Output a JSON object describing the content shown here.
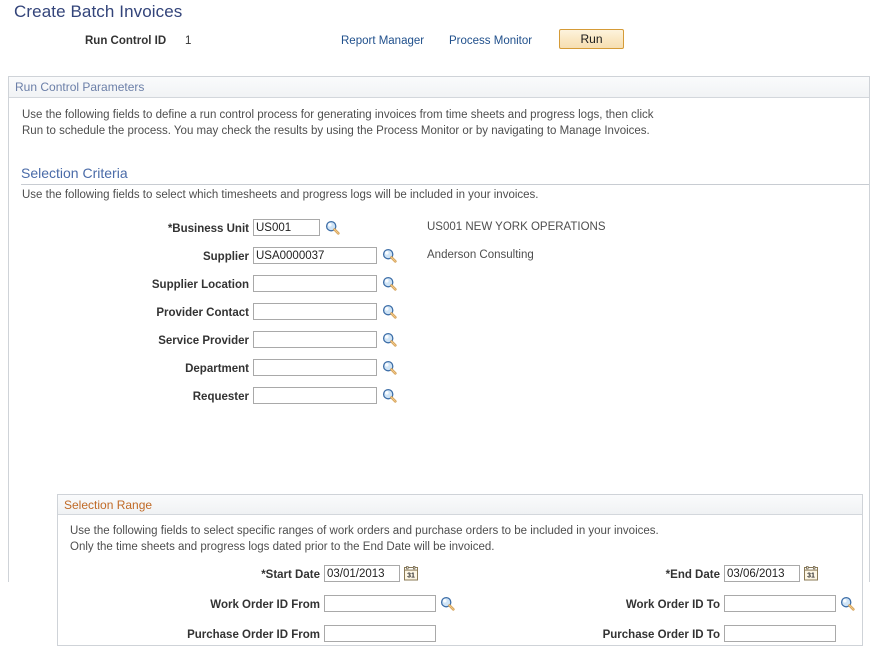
{
  "page": {
    "title": "Create Batch Invoices"
  },
  "header": {
    "run_control_label": "Run Control ID",
    "run_control_value": "1",
    "report_manager_link": "Report Manager",
    "process_monitor_link": "Process Monitor",
    "run_button": "Run"
  },
  "run_control_parameters": {
    "header": "Run Control Parameters",
    "intro_line1": "Use the following fields to define a run control process for generating invoices from time sheets and progress logs, then click",
    "intro_line2": "Run to schedule the process. You may check the results by using the Process Monitor or by navigating to Manage Invoices."
  },
  "selection_criteria": {
    "header": "Selection Criteria",
    "subtitle": "Use the following fields to select which timesheets and progress logs will be included in your invoices.",
    "fields": [
      {
        "label": "*Business Unit",
        "value": "US001",
        "placeholder": "",
        "width": "w-short",
        "lookup": true,
        "lookup_icon": "magnifier-icon",
        "side_text": "US001 NEW YORK OPERATIONS"
      },
      {
        "label": "Supplier",
        "value": "USA0000037",
        "placeholder": "",
        "width": "w-mid",
        "lookup": true,
        "lookup_icon": "magnifier-icon",
        "side_text": "Anderson Consulting"
      },
      {
        "label": "Supplier Location",
        "value": "",
        "placeholder": "",
        "width": "w-mid",
        "lookup": true,
        "lookup_icon": "magnifier-icon",
        "side_text": ""
      },
      {
        "label": "Provider Contact",
        "value": "",
        "placeholder": "",
        "width": "w-mid",
        "lookup": true,
        "lookup_icon": "magnifier-icon",
        "side_text": ""
      },
      {
        "label": "Service Provider",
        "value": "",
        "placeholder": "",
        "width": "w-mid",
        "lookup": true,
        "lookup_icon": "magnifier-icon",
        "side_text": ""
      },
      {
        "label": "Department",
        "value": "",
        "placeholder": "",
        "width": "w-mid",
        "lookup": true,
        "lookup_icon": "magnifier-icon",
        "side_text": ""
      },
      {
        "label": "Requester",
        "value": "",
        "placeholder": "",
        "width": "w-mid",
        "lookup": true,
        "lookup_icon": "magnifier-icon",
        "side_text": ""
      }
    ]
  },
  "selection_range": {
    "header": "Selection Range",
    "intro_line1": "Use the following fields to select specific ranges of work orders and purchase orders to be included in your invoices.",
    "intro_line2": "Only the time sheets and progress logs dated prior to the End Date will be invoiced.",
    "rows": [
      {
        "left": {
          "label": "*Start Date",
          "value": "03/01/2013",
          "placeholder": "",
          "size": "date",
          "icon": "calendar-icon"
        },
        "right": {
          "label": "*End Date",
          "value": "03/06/2013",
          "placeholder": "",
          "size": "date",
          "icon": "calendar-icon"
        }
      },
      {
        "left": {
          "label": "Work Order ID From",
          "value": "",
          "placeholder": "",
          "size": "ord",
          "icon": "magnifier-icon"
        },
        "right": {
          "label": "Work Order ID To",
          "value": "",
          "placeholder": "",
          "size": "ord",
          "icon": "magnifier-icon"
        }
      },
      {
        "left": {
          "label": "Purchase Order ID From",
          "value": "",
          "placeholder": "",
          "size": "ord",
          "icon": ""
        },
        "right": {
          "label": "Purchase Order ID To",
          "value": "",
          "placeholder": "",
          "size": "ord",
          "icon": ""
        }
      }
    ]
  },
  "colors": {
    "title_blue": "#33447a",
    "link_blue": "#20508c",
    "section_blue": "#4a6ba8",
    "subsection_orange": "#c06a27",
    "button_border": "#d59b37"
  }
}
